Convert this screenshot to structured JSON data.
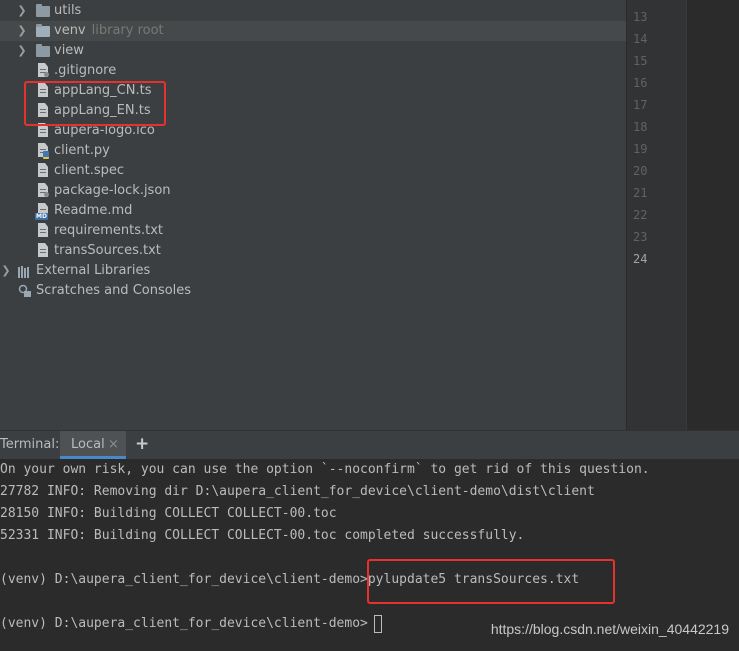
{
  "project_tree": {
    "items": [
      {
        "label": "utils",
        "kind": "folder",
        "expandable": true
      },
      {
        "label": "venv",
        "hint": "library root",
        "kind": "folder",
        "expandable": true,
        "selected": true
      },
      {
        "label": "view",
        "kind": "folder",
        "expandable": true
      },
      {
        "label": ".gitignore",
        "kind": "file"
      },
      {
        "label": "appLang_CN.ts",
        "kind": "file"
      },
      {
        "label": "appLang_EN.ts",
        "kind": "file"
      },
      {
        "label": "aupera-logo.ico",
        "kind": "file"
      },
      {
        "label": "client.py",
        "kind": "python-file"
      },
      {
        "label": "client.spec",
        "kind": "file"
      },
      {
        "label": "package-lock.json",
        "kind": "file"
      },
      {
        "label": "Readme.md",
        "kind": "markdown-file"
      },
      {
        "label": "requirements.txt",
        "kind": "file"
      },
      {
        "label": "transSources.txt",
        "kind": "file"
      },
      {
        "label": "External Libraries",
        "kind": "libraries",
        "expandable": true
      },
      {
        "label": "Scratches and Consoles",
        "kind": "scratches"
      }
    ]
  },
  "gutter": {
    "line_numbers": [
      "13",
      "14",
      "15",
      "16",
      "17",
      "18",
      "19",
      "20",
      "21",
      "22",
      "23",
      "24"
    ],
    "current_line": "24"
  },
  "terminal": {
    "title": "Terminal:",
    "tab_label": "Local",
    "close_glyph": "×",
    "add_glyph": "+",
    "lines": [
      "On your own risk, you can use the option `--noconfirm` to get rid of this question.",
      "27782 INFO: Removing dir D:\\aupera_client_for_device\\client-demo\\dist\\client",
      "28150 INFO: Building COLLECT COLLECT-00.toc",
      "52331 INFO: Building COLLECT COLLECT-00.toc completed successfully.",
      "",
      "(venv) D:\\aupera_client_for_device\\client-demo>pylupdate5 transSources.txt",
      "",
      "(venv) D:\\aupera_client_for_device\\client-demo>"
    ]
  },
  "watermark": "https://blog.csdn.net/weixin_40442219",
  "colors": {
    "highlight_box": "#e5322d",
    "panel_bg": "#3c3f41",
    "editor_bg": "#2b2b2b",
    "text": "#bbbbbb"
  }
}
